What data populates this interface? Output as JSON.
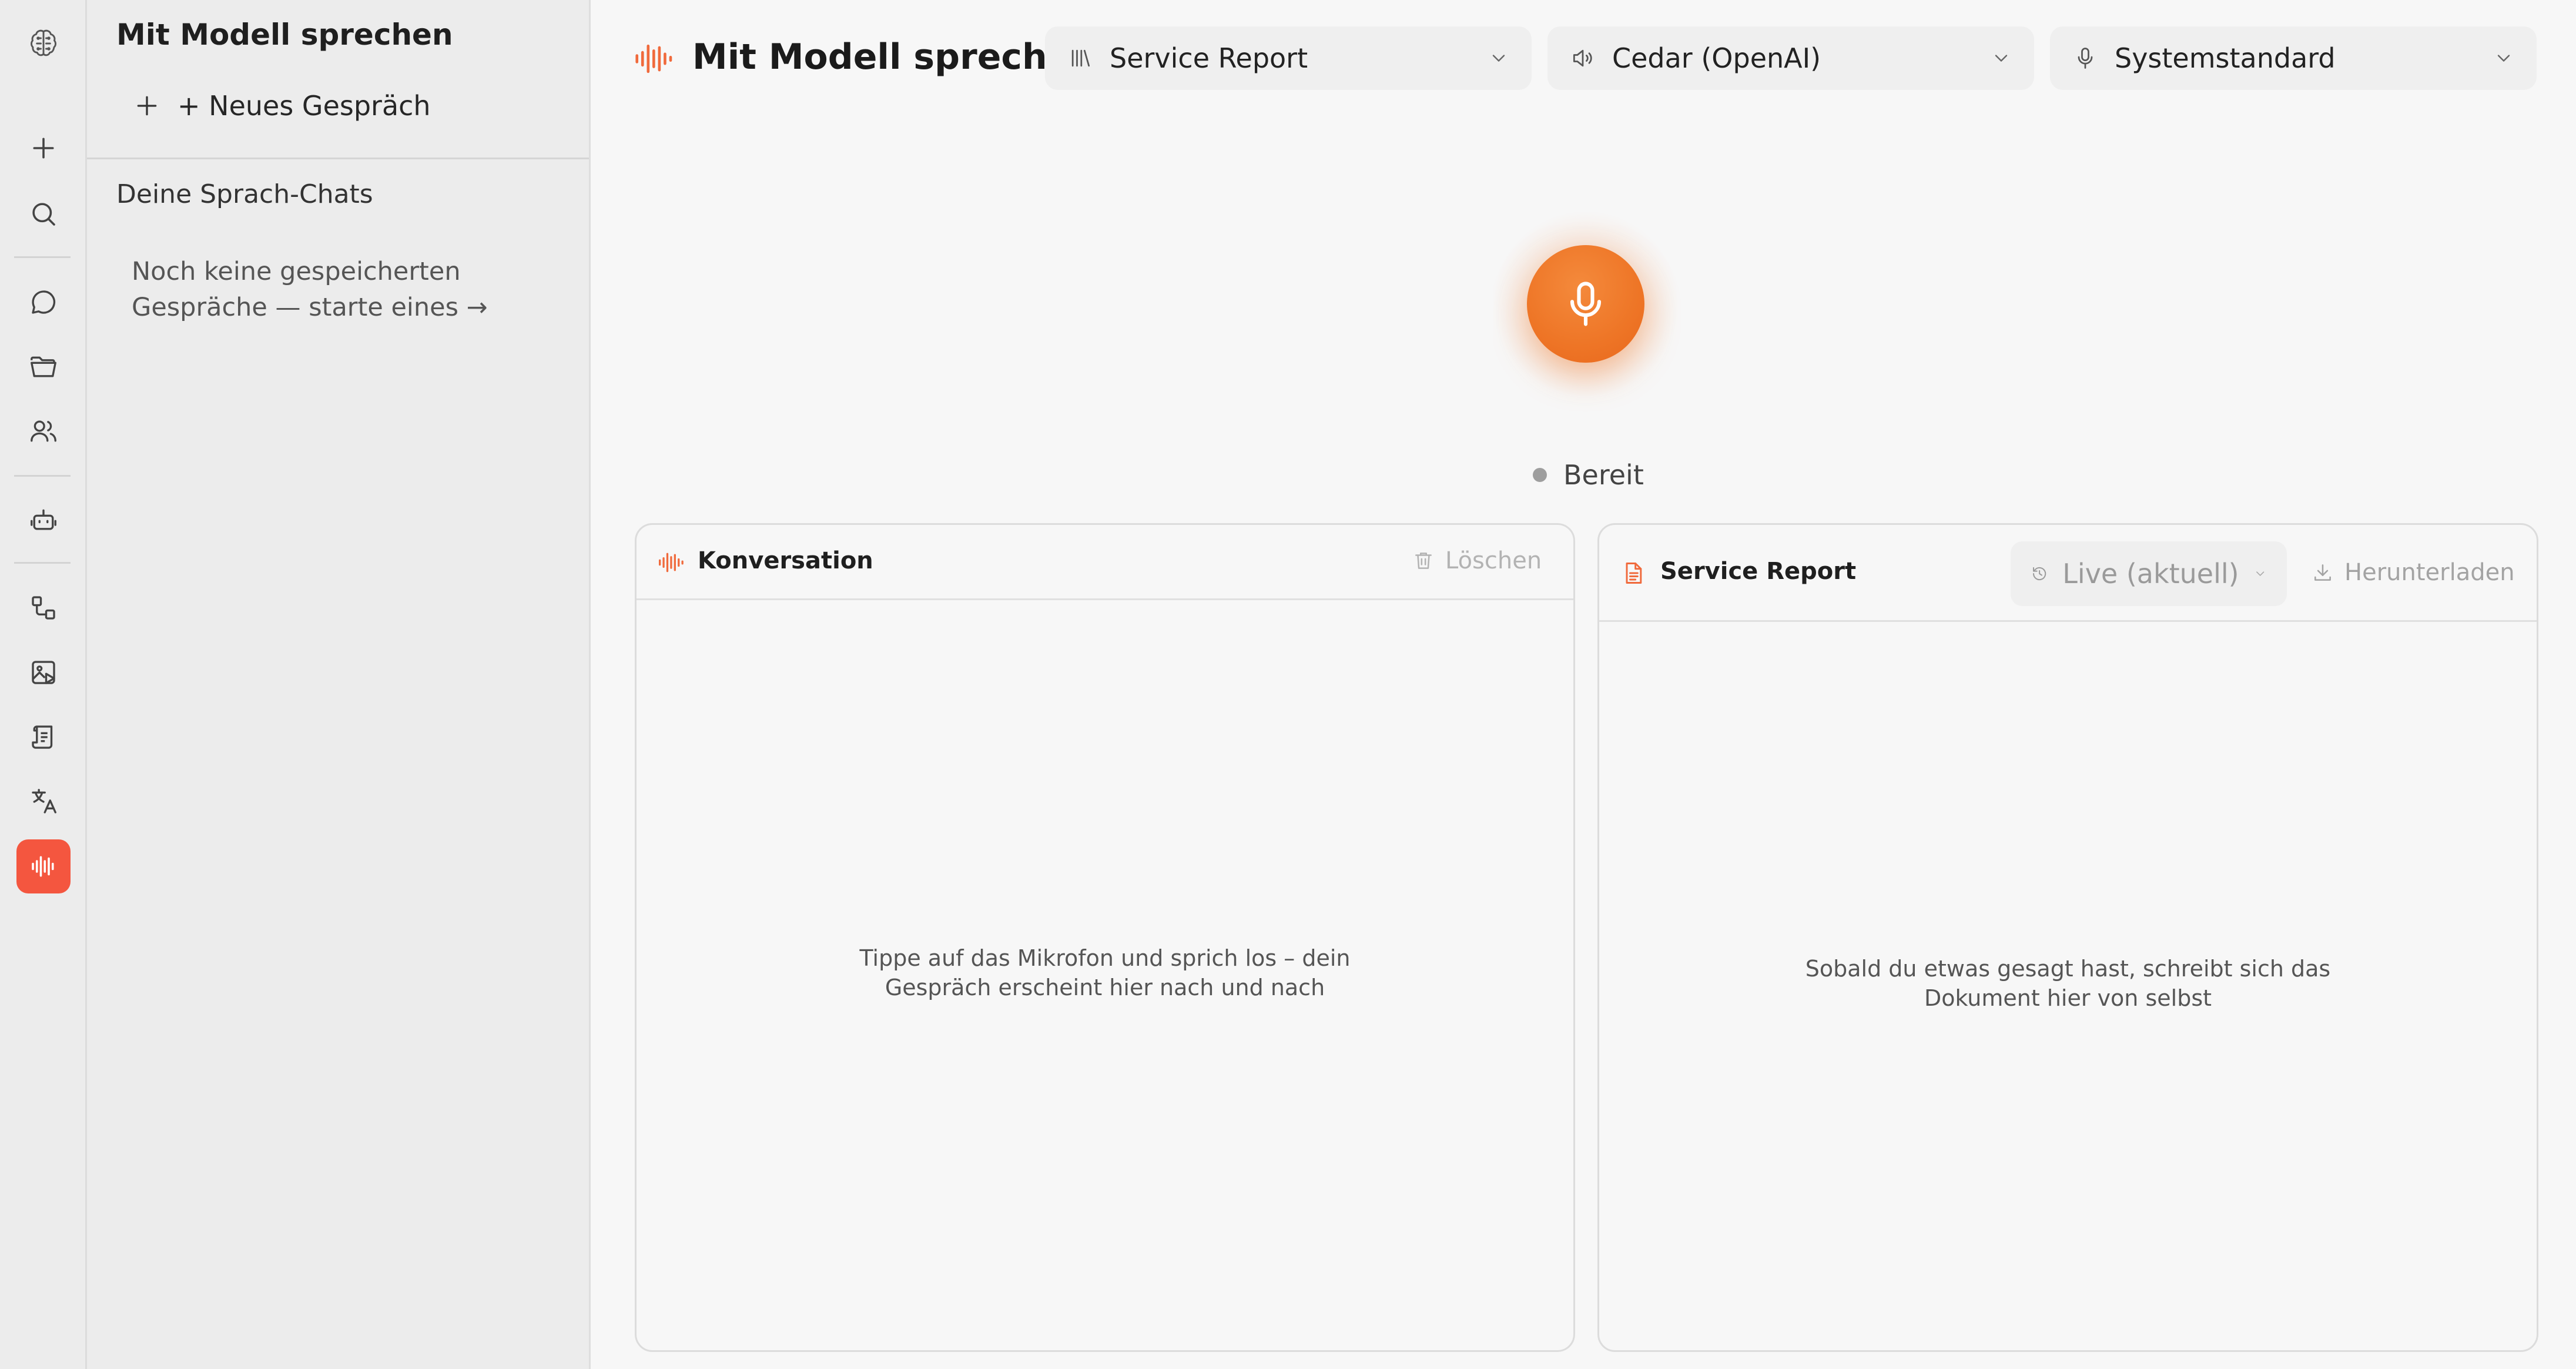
{
  "sidebar": {
    "title": "Mit Modell sprechen",
    "new_chat_label": "+ Neues Gespräch",
    "section_title": "Deine Sprach-Chats",
    "empty_line1": "Noch keine gespeicherten",
    "empty_line2": "Gespräche — starte eines →"
  },
  "rail": {
    "items": [
      "logo-icon",
      "plus-icon",
      "search-icon",
      "chat-icon",
      "folder-icon",
      "users-icon",
      "bot-icon",
      "workflow-icon",
      "image-icon",
      "document-icon",
      "translate-icon",
      "voice-icon"
    ],
    "active": "voice-icon",
    "active_color": "#f4563f"
  },
  "header": {
    "title": "Mit Modell sprechen",
    "template_select": "Service Report",
    "voice_select": "Cedar (OpenAI)",
    "mic_select": "Systemstandard"
  },
  "mic": {
    "status": "Bereit",
    "accent_color": "#ee7526"
  },
  "conversation": {
    "title": "Konversation",
    "clear_label": "Löschen",
    "empty_line1": "Tippe auf das Mikrofon und sprich los – dein",
    "empty_line2": "Gespräch erscheint hier nach und nach"
  },
  "report": {
    "title": "Service Report",
    "version_select": "Live (aktuell)",
    "download_label": "Herunterladen",
    "empty_line1": "Sobald du etwas gesagt hast, schreibt sich das",
    "empty_line2": "Dokument hier von selbst"
  }
}
